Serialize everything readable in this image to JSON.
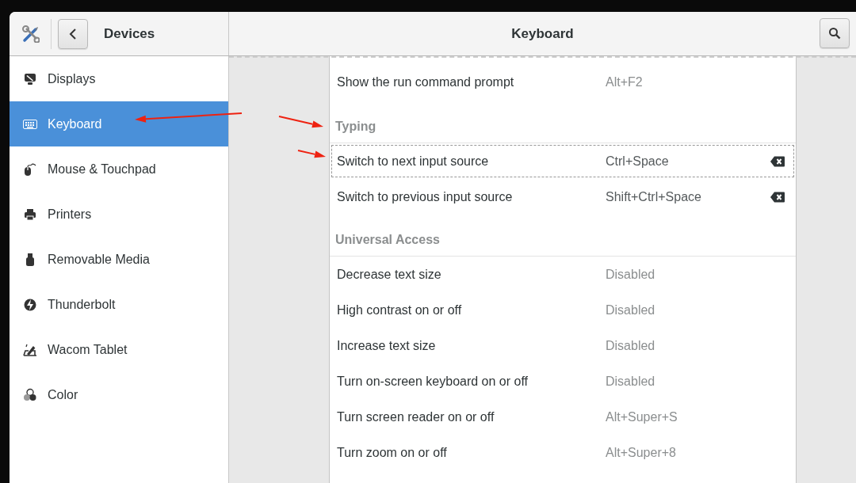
{
  "header": {
    "panel_title": "Devices",
    "page_title": "Keyboard"
  },
  "sidebar": {
    "items": [
      {
        "label": "Displays",
        "selected": false
      },
      {
        "label": "Keyboard",
        "selected": true
      },
      {
        "label": "Mouse & Touchpad",
        "selected": false
      },
      {
        "label": "Printers",
        "selected": false
      },
      {
        "label": "Removable Media",
        "selected": false
      },
      {
        "label": "Thunderbolt",
        "selected": false
      },
      {
        "label": "Wacom Tablet",
        "selected": false
      },
      {
        "label": "Color",
        "selected": false
      }
    ]
  },
  "shortcut_list": {
    "rows": [
      {
        "kind": "shortcut",
        "label": "Show the run command prompt",
        "accelerator": "Alt+F2",
        "modified": false,
        "focused": false
      },
      {
        "kind": "heading",
        "label": "Typing"
      },
      {
        "kind": "shortcut",
        "label": "Switch to next input source",
        "accelerator": "Ctrl+Space",
        "modified": true,
        "focused": true
      },
      {
        "kind": "shortcut",
        "label": "Switch to previous input source",
        "accelerator": "Shift+Ctrl+Space",
        "modified": true,
        "focused": false
      },
      {
        "kind": "heading",
        "label": "Universal Access"
      },
      {
        "kind": "shortcut",
        "label": "Decrease text size",
        "accelerator": "Disabled",
        "modified": false,
        "focused": false
      },
      {
        "kind": "shortcut",
        "label": "High contrast on or off",
        "accelerator": "Disabled",
        "modified": false,
        "focused": false
      },
      {
        "kind": "shortcut",
        "label": "Increase text size",
        "accelerator": "Disabled",
        "modified": false,
        "focused": false
      },
      {
        "kind": "shortcut",
        "label": "Turn on-screen keyboard on or off",
        "accelerator": "Disabled",
        "modified": false,
        "focused": false
      },
      {
        "kind": "shortcut",
        "label": "Turn screen reader on or off",
        "accelerator": "Alt+Super+S",
        "modified": false,
        "focused": false
      },
      {
        "kind": "shortcut",
        "label": "Turn zoom on or off",
        "accelerator": "Alt+Super+8",
        "modified": false,
        "focused": false
      }
    ]
  },
  "annotations": [
    {
      "kind": "arrow"
    },
    {
      "kind": "arrow"
    },
    {
      "kind": "arrow"
    }
  ]
}
